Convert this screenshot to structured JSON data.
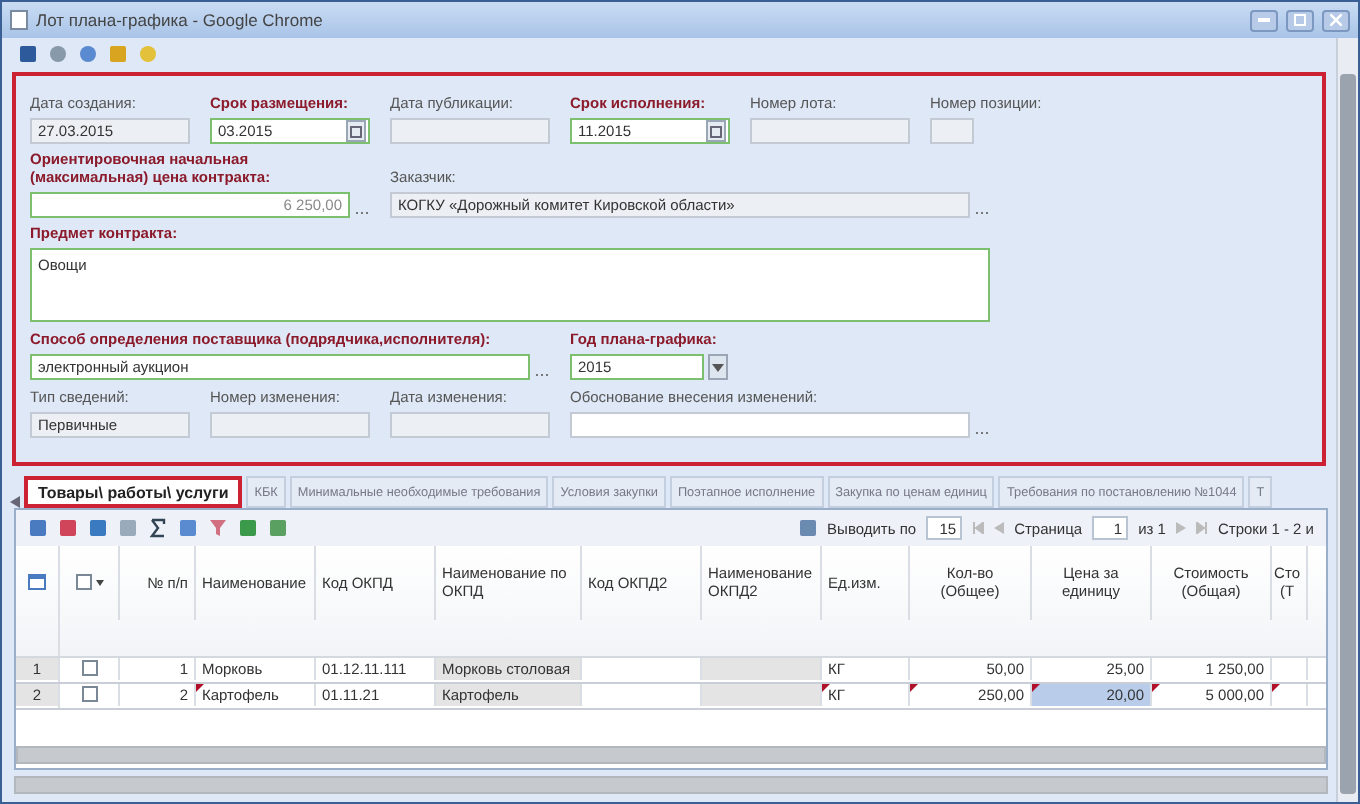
{
  "window": {
    "title": "Лот плана-графика - Google Chrome"
  },
  "form": {
    "rows": [
      [
        {
          "label": "Дата создания:",
          "value": "27.03.2015",
          "kind": "text",
          "required": false,
          "disabled": true
        },
        {
          "label": "Срок размещения:",
          "value": "03.2015",
          "kind": "date",
          "required": true,
          "disabled": false
        },
        {
          "label": "Дата публикации:",
          "kind": "text",
          "required": false,
          "disabled": true
        },
        {
          "label": "Срок исполнения:",
          "value": "11.2015",
          "kind": "date",
          "required": true,
          "disabled": false
        },
        {
          "label": "Номер лота:",
          "kind": "text",
          "required": false,
          "disabled": true
        },
        {
          "label": "Номер позиции:",
          "kind": "text",
          "required": false,
          "disabled": true
        }
      ],
      [
        {
          "label": "Ориентировочная начальная (максимальная) цена контракта:",
          "value": "6 250,00",
          "kind": "money",
          "required": true,
          "disabled": false
        },
        {
          "label": "Заказчик:",
          "value": "КОГКУ «Дорожный комитет Кировской области»",
          "kind": "lookup",
          "required": false,
          "disabled": true
        }
      ],
      [
        {
          "label": "Предмет контракта:",
          "value": "Овощи",
          "kind": "textarea",
          "required": true,
          "disabled": false
        }
      ],
      [
        {
          "label": "Способ определения поставщика (подрядчика,исполнителя):",
          "value": "электронный аукцион",
          "kind": "lookup",
          "required": true,
          "disabled": false
        },
        {
          "label": "Год плана-графика:",
          "value": "2015",
          "kind": "select",
          "required": true,
          "disabled": false
        }
      ],
      [
        {
          "label": "Тип сведений:",
          "value": "Первичные",
          "kind": "text",
          "required": false,
          "disabled": true
        },
        {
          "label": "Номер изменения:",
          "kind": "text",
          "required": false,
          "disabled": true
        },
        {
          "label": "Дата изменения:",
          "kind": "text",
          "required": false,
          "disabled": true
        },
        {
          "label": "Обоснование внесения изменений:",
          "kind": "lookup",
          "required": false,
          "disabled": false
        }
      ]
    ]
  },
  "tabs": [
    {
      "label": "Товары\\ работы\\ услуги",
      "selected": true
    },
    {
      "label": "КБК",
      "selected": false
    },
    {
      "label": "Минимальные необходимые требования",
      "selected": false
    },
    {
      "label": "Условия закупки",
      "selected": false
    },
    {
      "label": "Поэтапное исполнение",
      "selected": false
    },
    {
      "label": "Закупка по ценам единиц",
      "selected": false
    },
    {
      "label": "Требования по постановлению №1044",
      "selected": false
    },
    {
      "label": "Т",
      "selected": false
    }
  ],
  "pager": {
    "per_page_label": "Выводить по",
    "per_page": "15",
    "page_label": "Страница",
    "page": "1",
    "page_of": "из 1",
    "rows_info": "Строки 1 - 2 и"
  },
  "grid": {
    "select_all": false,
    "columns": [
      {
        "title": "№ п/п",
        "readonly": false
      },
      {
        "title": "Наименование",
        "readonly": false
      },
      {
        "title": "Код ОКПД",
        "readonly": false
      },
      {
        "title": "Наименование по ОКПД",
        "readonly": true
      },
      {
        "title": "Код ОКПД2",
        "readonly": false
      },
      {
        "title": "Наименование ОКПД2",
        "readonly": true
      },
      {
        "title": "Ед.изм.",
        "readonly": false
      },
      {
        "title": "Кол-во (Общее)",
        "readonly": false
      },
      {
        "title": "Цена за единицу",
        "readonly": false
      },
      {
        "title": "Стоимость (Общая)",
        "readonly": false
      },
      {
        "title": "Сто (Т",
        "readonly": false
      }
    ],
    "rows": [
      {
        "number": "1",
        "checked": false,
        "selected": false,
        "edited": false,
        "n": "1",
        "name": "Морковь",
        "okpd": "01.12.11.111",
        "okpd_name": "Морковь столовая",
        "unit": "КГ",
        "qty": "50,00",
        "price": "25,00",
        "cost": "1 250,00"
      },
      {
        "number": "2",
        "checked": false,
        "selected": true,
        "edited": true,
        "n": "2",
        "name": "Картофель",
        "okpd": "01.11.21",
        "okpd_name": "Картофель",
        "unit": "КГ",
        "qty": "250,00",
        "price": "20,00",
        "cost": "5 000,00"
      }
    ]
  }
}
